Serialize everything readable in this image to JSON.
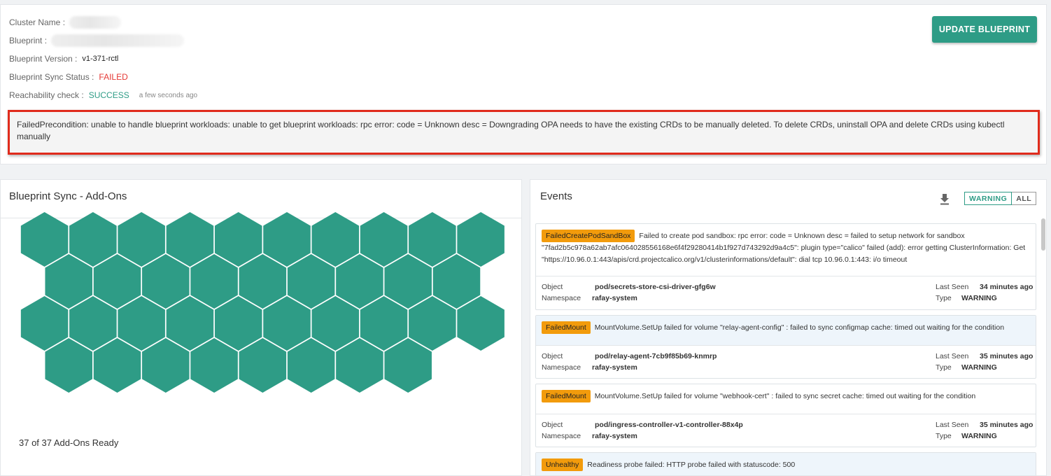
{
  "cluster": {
    "name_label": "Cluster Name :",
    "blueprint_label": "Blueprint :",
    "version_label": "Blueprint Version :",
    "version_value": "v1-371-rctl",
    "sync_label": "Blueprint Sync Status :",
    "sync_value": "FAILED",
    "reach_label": "Reachability check :",
    "reach_value": "SUCCESS",
    "reach_time": "a few seconds ago",
    "update_button": "UPDATE BLUEPRINT",
    "error_message": "FailedPrecondition: unable to handle blueprint workloads: unable to get blueprint workloads: rpc error: code = Unknown desc = Downgrading OPA needs to have the existing CRDs to be manually deleted. To delete CRDs, uninstall OPA and delete CRDs using kubectl manually"
  },
  "addons": {
    "title": "Blueprint Sync - Add-Ons",
    "ready_total": 37,
    "ready_text": "37 of 37 Add-Ons Ready",
    "hex_color": "#2e9c86"
  },
  "events": {
    "title": "Events",
    "download_icon": "download-icon",
    "filters": [
      "WARNING",
      "ALL"
    ],
    "active_filter": "WARNING",
    "items": [
      {
        "reason": "FailedCreatePodSandBox",
        "message": "Failed to create pod sandbox: rpc error: code = Unknown desc = failed to setup network for sandbox \"7fad2b5c978a62ab7afc064028556168e6f4f29280414b1f927d743292d9a4c5\": plugin type=\"calico\" failed (add): error getting ClusterInformation: Get \"https://10.96.0.1:443/apis/crd.projectcalico.org/v1/clusterinformations/default\": dial tcp 10.96.0.1:443: i/o timeout",
        "object_label": "Object",
        "object": "pod/secrets-store-csi-driver-gfg6w",
        "namespace_label": "Namespace",
        "namespace": "rafay-system",
        "last_seen_label": "Last Seen",
        "last_seen": "34 minutes ago",
        "type_label": "Type",
        "type": "WARNING"
      },
      {
        "reason": "FailedMount",
        "message": "MountVolume.SetUp failed for volume \"relay-agent-config\" : failed to sync configmap cache: timed out waiting for the condition",
        "object_label": "Object",
        "object": "pod/relay-agent-7cb9f85b69-knmrp",
        "namespace_label": "Namespace",
        "namespace": "rafay-system",
        "last_seen_label": "Last Seen",
        "last_seen": "35 minutes ago",
        "type_label": "Type",
        "type": "WARNING"
      },
      {
        "reason": "FailedMount",
        "message": "MountVolume.SetUp failed for volume \"webhook-cert\" : failed to sync secret cache: timed out waiting for the condition",
        "object_label": "Object",
        "object": "pod/ingress-controller-v1-controller-88x4p",
        "namespace_label": "Namespace",
        "namespace": "rafay-system",
        "last_seen_label": "Last Seen",
        "last_seen": "35 minutes ago",
        "type_label": "Type",
        "type": "WARNING"
      },
      {
        "reason": "Unhealthy",
        "message": "Readiness probe failed: HTTP probe failed with statuscode: 500"
      }
    ]
  }
}
